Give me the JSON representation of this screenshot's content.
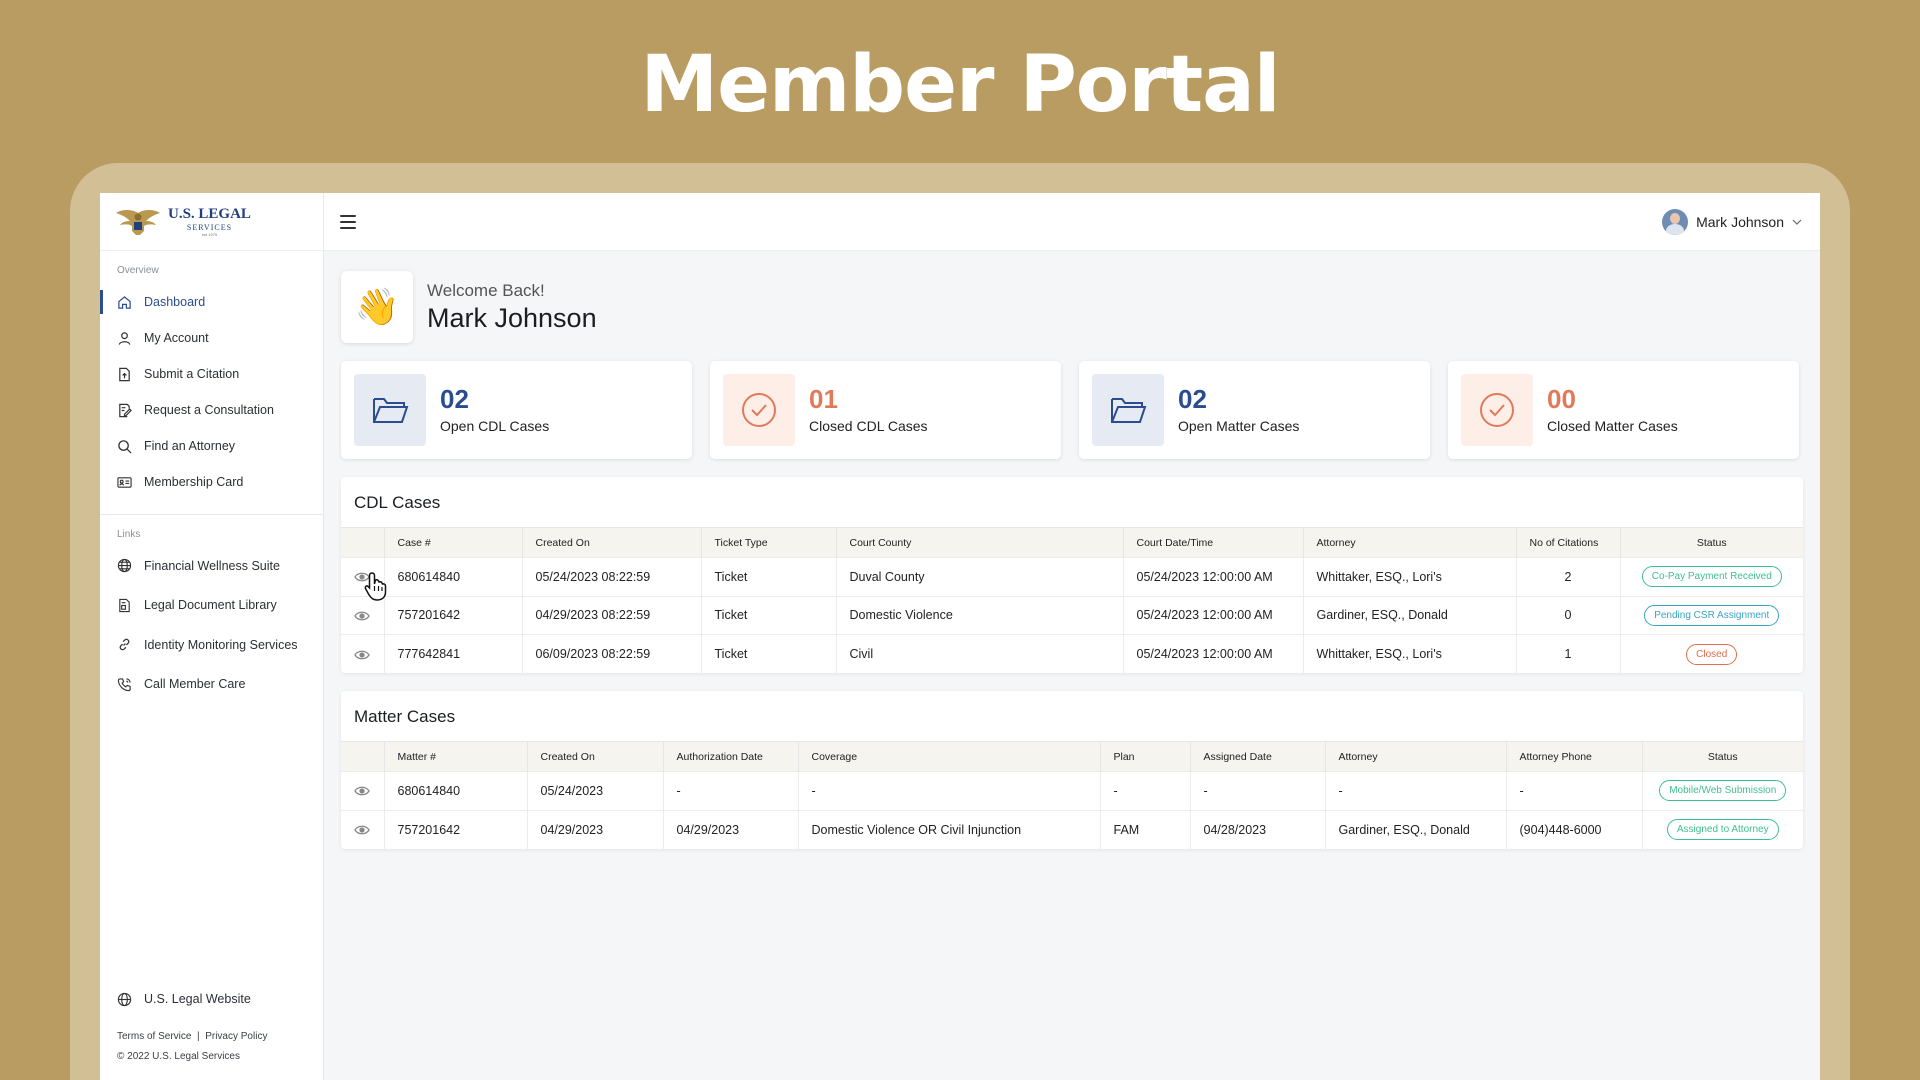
{
  "page_heading": "Member Portal",
  "logo": {
    "title": "U.S. LEGAL",
    "subtitle": "SERVICES",
    "tiny": "est 1975"
  },
  "sidebar": {
    "overview_label": "Overview",
    "items": [
      {
        "label": "Dashboard",
        "icon": "home-icon"
      },
      {
        "label": "My Account",
        "icon": "user-icon"
      },
      {
        "label": "Submit a Citation",
        "icon": "upload-file-icon"
      },
      {
        "label": "Request a Consultation",
        "icon": "edit-document-icon"
      },
      {
        "label": "Find an Attorney",
        "icon": "search-icon"
      },
      {
        "label": "Membership Card",
        "icon": "id-card-icon"
      }
    ],
    "links_label": "Links",
    "links": [
      {
        "label": "Financial Wellness Suite",
        "icon": "globe-icon"
      },
      {
        "label": "Legal Document Library",
        "icon": "document-library-icon"
      },
      {
        "label": "Identity Monitoring Services",
        "icon": "link-icon"
      },
      {
        "label": "Call Member Care",
        "icon": "phone-icon"
      }
    ],
    "website_label": "U.S. Legal Website",
    "terms": "Terms of Service",
    "separator": "|",
    "privacy": "Privacy Policy",
    "copyright": "© 2022 U.S. Legal Services"
  },
  "topbar": {
    "user_name": "Mark Johnson"
  },
  "welcome": {
    "greeting": "Welcome Back!",
    "name": "Mark Johnson",
    "emoji": "👋"
  },
  "stats": [
    {
      "value": "02",
      "label": "Open CDL Cases",
      "icon": "folder-icon"
    },
    {
      "value": "01",
      "label": "Closed CDL Cases",
      "icon": "check-circle-icon"
    },
    {
      "value": "02",
      "label": "Open Matter Cases",
      "icon": "folder-icon"
    },
    {
      "value": "00",
      "label": "Closed Matter Cases",
      "icon": "check-circle-icon"
    }
  ],
  "cdl": {
    "title": "CDL Cases",
    "columns": [
      "Case #",
      "Created On",
      "Ticket Type",
      "Court County",
      "Court Date/Time",
      "Attorney",
      "No of Citations",
      "Status"
    ],
    "rows": [
      {
        "case": "680614840",
        "created": "05/24/2023 08:22:59",
        "type": "Ticket",
        "county": "Duval County",
        "court_date": "05/24/2023 12:00:00 AM",
        "attorney": "Whittaker, ESQ., Lori's",
        "citations": "2",
        "status": "Co-Pay Payment Received"
      },
      {
        "case": "757201642",
        "created": "04/29/2023 08:22:59",
        "type": "Ticket",
        "county": "Domestic Violence",
        "court_date": "05/24/2023 12:00:00 AM",
        "attorney": "Gardiner, ESQ., Donald",
        "citations": "0",
        "status": "Pending CSR Assignment"
      },
      {
        "case": "777642841",
        "created": "06/09/2023 08:22:59",
        "type": "Ticket",
        "county": "Civil",
        "court_date": "05/24/2023 12:00:00 AM",
        "attorney": "Whittaker, ESQ., Lori's",
        "citations": "1",
        "status": "Closed"
      }
    ]
  },
  "matter": {
    "title": "Matter Cases",
    "columns": [
      "Matter #",
      "Created On",
      "Authorization Date",
      "Coverage",
      "Plan",
      "Assigned Date",
      "Attorney",
      "Attorney Phone",
      "Status"
    ],
    "rows": [
      {
        "matter": "680614840",
        "created": "05/24/2023",
        "auth": "-",
        "coverage": "-",
        "plan": "-",
        "assigned": "-",
        "attorney": "-",
        "phone": "-",
        "status": "Mobile/Web Submission"
      },
      {
        "matter": "757201642",
        "created": "04/29/2023",
        "auth": "04/29/2023",
        "coverage": "Domestic Violence OR Civil Injunction",
        "plan": "FAM",
        "assigned": "04/28/2023",
        "attorney": "Gardiner, ESQ., Donald",
        "phone": "(904)448-6000",
        "status": "Assigned to Attorney"
      }
    ]
  },
  "colors": {
    "background": "#b99c62",
    "brand_blue": "#2a4d8f",
    "accent_peach": "#e07a5a",
    "status_green": "#3fbf8f",
    "status_blue": "#3aa3c6",
    "status_red": "#e26d52"
  }
}
